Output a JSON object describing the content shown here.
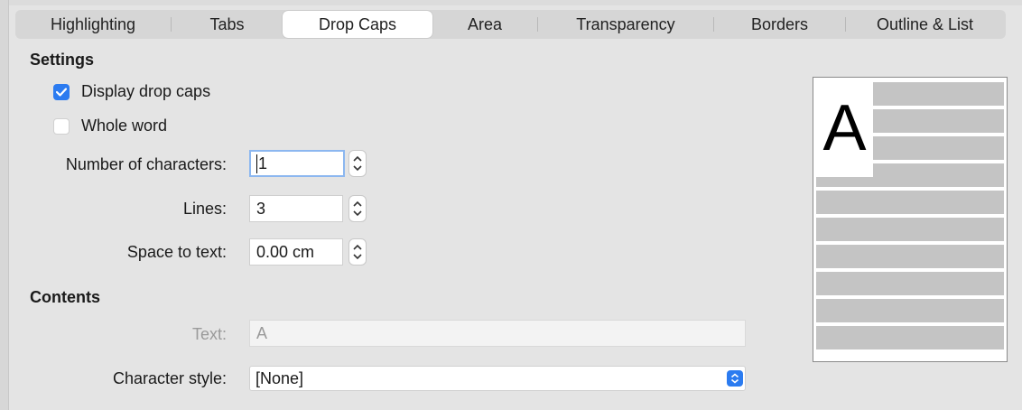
{
  "tabs": [
    {
      "label": "Highlighting",
      "active": false
    },
    {
      "label": "Tabs",
      "active": false
    },
    {
      "label": "Drop Caps",
      "active": true
    },
    {
      "label": "Area",
      "active": false
    },
    {
      "label": "Transparency",
      "active": false
    },
    {
      "label": "Borders",
      "active": false
    },
    {
      "label": "Outline & List",
      "active": false
    }
  ],
  "settings": {
    "title": "Settings",
    "display_drop_caps": {
      "label": "Display drop caps",
      "checked": true
    },
    "whole_word": {
      "label": "Whole word",
      "checked": false
    },
    "number_of_characters": {
      "label": "Number of characters:",
      "value": "1"
    },
    "lines": {
      "label": "Lines:",
      "value": "3"
    },
    "space_to_text": {
      "label": "Space to text:",
      "value": "0.00 cm"
    }
  },
  "contents": {
    "title": "Contents",
    "text": {
      "label": "Text:",
      "value": "A"
    },
    "character_style": {
      "label": "Character style:",
      "value": "[None]"
    }
  },
  "preview": {
    "drop_cap_letter": "A"
  },
  "colors": {
    "accent": "#2b7bf0",
    "background": "#e4e4e4",
    "preview_line": "#c4c4c4"
  }
}
